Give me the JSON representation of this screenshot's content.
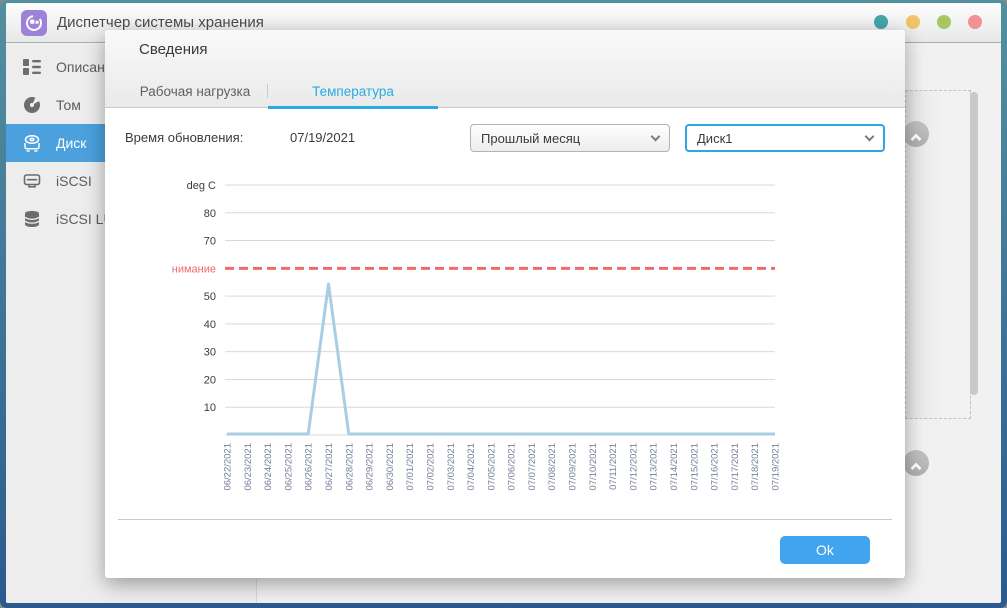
{
  "window": {
    "title": "Диспетчер системы хранения",
    "controls": [
      {
        "name": "teal-dot",
        "color": "#44a5a8"
      },
      {
        "name": "yellow-dot",
        "color": "#eec569"
      },
      {
        "name": "green-dot",
        "color": "#a6c75f"
      },
      {
        "name": "red-dot",
        "color": "#ef9196"
      }
    ]
  },
  "sidebar": {
    "selected_color": "#4ba0dd",
    "items": [
      {
        "label": "Описание",
        "icon": "overview-icon",
        "selected": false
      },
      {
        "label": "Том",
        "icon": "volume-icon",
        "selected": false
      },
      {
        "label": "Диск",
        "icon": "disk-icon",
        "selected": true
      },
      {
        "label": "iSCSI",
        "icon": "iscsi-icon",
        "selected": false
      },
      {
        "label": "iSCSI LUN",
        "icon": "iscsi-lun-icon",
        "selected": false
      }
    ]
  },
  "modal": {
    "title": "Сведения",
    "tabs": [
      {
        "label": "Рабочая нагрузка",
        "active": false
      },
      {
        "label": "Температура",
        "active": true
      }
    ],
    "accent_color": "#29abe2",
    "update_time_label": "Время обновления:",
    "update_time_value": "07/19/2021",
    "period_select": {
      "value": "Прошлый месяц",
      "icon": "chevron-down-icon"
    },
    "disk_select": {
      "value": "Диск1",
      "icon": "chevron-down-icon",
      "border_color": "#29a9e0"
    },
    "ok_button": {
      "label": "Ok",
      "color": "#41a4ef"
    }
  },
  "chart_data": {
    "type": "line",
    "unit_label": "deg C",
    "x": [
      "06/22/2021",
      "06/23/2021",
      "06/24/2021",
      "06/25/2021",
      "06/26/2021",
      "06/27/2021",
      "06/28/2021",
      "06/29/2021",
      "06/30/2021",
      "07/01/2021",
      "07/02/2021",
      "07/03/2021",
      "07/04/2021",
      "07/05/2021",
      "07/06/2021",
      "07/07/2021",
      "07/08/2021",
      "07/09/2021",
      "07/10/2021",
      "07/11/2021",
      "07/12/2021",
      "07/13/2021",
      "07/14/2021",
      "07/15/2021",
      "07/16/2021",
      "07/17/2021",
      "07/18/2021",
      "07/19/2021"
    ],
    "series": [
      {
        "name": "Диск1",
        "values": [
          0,
          0,
          0,
          0,
          0,
          54,
          0,
          0,
          0,
          0,
          0,
          0,
          0,
          0,
          0,
          0,
          0,
          0,
          0,
          0,
          0,
          0,
          0,
          0,
          0,
          0,
          0,
          0
        ]
      }
    ],
    "ylim": [
      0,
      90
    ],
    "yticks": [
      {
        "value": 90,
        "label": "deg C"
      },
      {
        "value": 80,
        "label": "80"
      },
      {
        "value": 70,
        "label": "70"
      },
      {
        "value": 50,
        "label": "50"
      },
      {
        "value": 40,
        "label": "40"
      },
      {
        "value": 30,
        "label": "30"
      },
      {
        "value": 20,
        "label": "20"
      },
      {
        "value": 10,
        "label": "10"
      },
      {
        "value": 0,
        "label": ""
      }
    ],
    "warning_line": {
      "value": 60,
      "label": "нимание",
      "color": "#f2696d"
    },
    "line_color": "#a9cee3",
    "grid_color": "#d9d9d9",
    "x_label_color": "#75819b",
    "grid_on": true,
    "legend": "none"
  }
}
